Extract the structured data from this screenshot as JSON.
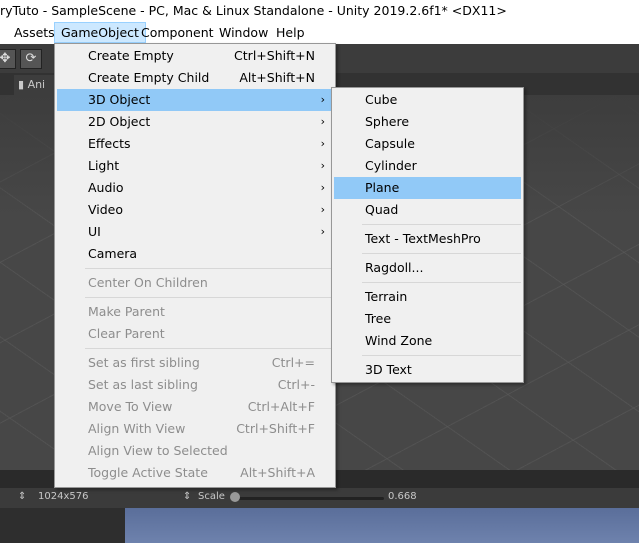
{
  "window": {
    "title": "ryTuto - SampleScene - PC, Mac & Linux Standalone - Unity 2019.2.6f1* <DX11>"
  },
  "menubar": {
    "items": [
      "Assets",
      "GameObject",
      "Component",
      "Window",
      "Help"
    ],
    "active": "GameObject"
  },
  "scene_tab": {
    "label": "Ani"
  },
  "game_toolbar": {
    "resolution": "1024x576",
    "scale_label": "Scale",
    "scale_value": "0.668",
    "scale_fraction": 0.02
  },
  "gameobject_menu": {
    "create_empty": {
      "label": "Create Empty",
      "shortcut": "Ctrl+Shift+N"
    },
    "create_empty_child": {
      "label": "Create Empty Child",
      "shortcut": "Alt+Shift+N"
    },
    "object_3d": {
      "label": "3D Object"
    },
    "object_2d": {
      "label": "2D Object"
    },
    "effects": {
      "label": "Effects"
    },
    "light": {
      "label": "Light"
    },
    "audio": {
      "label": "Audio"
    },
    "video": {
      "label": "Video"
    },
    "ui": {
      "label": "UI"
    },
    "camera": {
      "label": "Camera"
    },
    "center_on_children": {
      "label": "Center On Children"
    },
    "make_parent": {
      "label": "Make Parent"
    },
    "clear_parent": {
      "label": "Clear Parent"
    },
    "set_first_sibling": {
      "label": "Set as first sibling",
      "shortcut": "Ctrl+="
    },
    "set_last_sibling": {
      "label": "Set as last sibling",
      "shortcut": "Ctrl+-"
    },
    "move_to_view": {
      "label": "Move To View",
      "shortcut": "Ctrl+Alt+F"
    },
    "align_with_view": {
      "label": "Align With View",
      "shortcut": "Ctrl+Shift+F"
    },
    "align_view_to_selected": {
      "label": "Align View to Selected"
    },
    "toggle_active_state": {
      "label": "Toggle Active State",
      "shortcut": "Alt+Shift+A"
    }
  },
  "object3d_submenu": {
    "cube": "Cube",
    "sphere": "Sphere",
    "capsule": "Capsule",
    "cylinder": "Cylinder",
    "plane": "Plane",
    "quad": "Quad",
    "text_tmp": "Text - TextMeshPro",
    "ragdoll": "Ragdoll...",
    "terrain": "Terrain",
    "tree": "Tree",
    "wind_zone": "Wind Zone",
    "text_3d": "3D Text"
  },
  "colors": {
    "highlight": "#91c9f7",
    "menu_bg": "#f0f0f0",
    "menubar_active": "#cce8ff"
  }
}
